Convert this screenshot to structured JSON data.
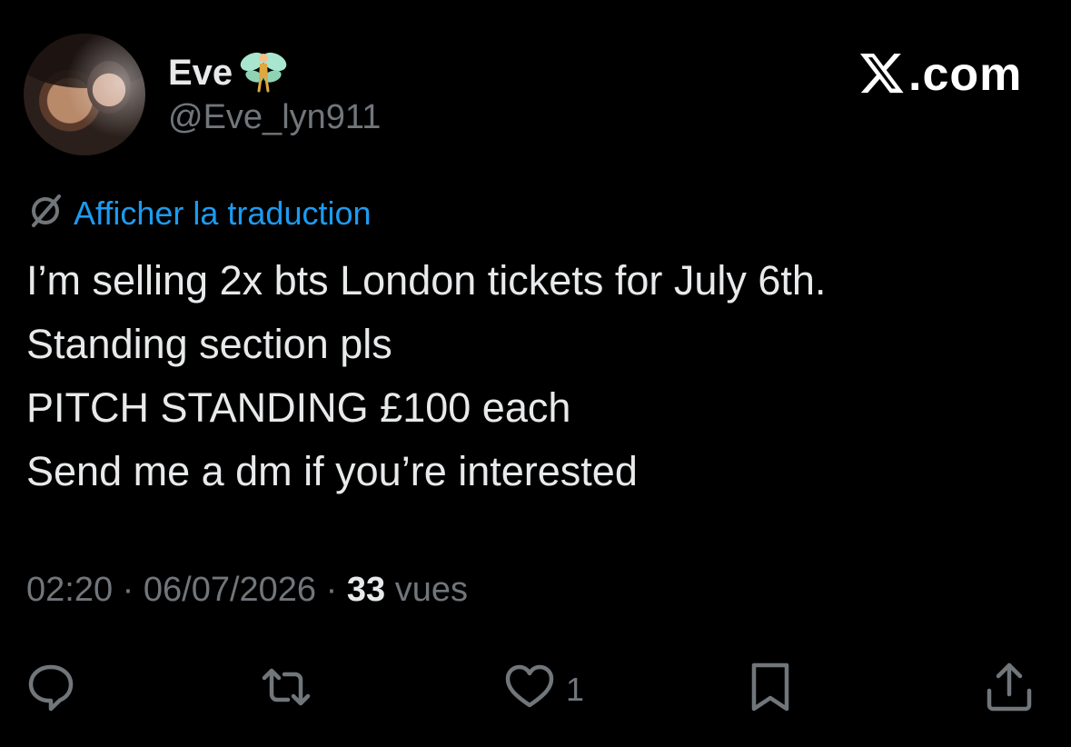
{
  "author": {
    "name": "Eve",
    "handle": "@Eve_lyn911",
    "emoji_icon": "fairy-emoji"
  },
  "brand": {
    "site": ".com",
    "logo_icon": "x-logo-icon"
  },
  "translate": {
    "label": "Afficher la traduction",
    "icon": "translate-icon",
    "color": "#1d9bf0"
  },
  "tweet": {
    "lines": [
      "I’m selling 2x bts London tickets for July 6th.",
      "Standing section pls",
      "PITCH STANDING £100 each",
      "Send me a dm if you’re interested"
    ]
  },
  "meta": {
    "time": "02:20",
    "date": "06/07/2026",
    "separator": "·",
    "views_count": "33",
    "views_label": "vues"
  },
  "actions": {
    "reply": {
      "icon": "reply-icon"
    },
    "retweet": {
      "icon": "retweet-icon"
    },
    "like": {
      "icon": "heart-icon",
      "count": "1"
    },
    "bookmark": {
      "icon": "bookmark-icon"
    },
    "share": {
      "icon": "share-icon"
    }
  },
  "colors": {
    "background": "#000000",
    "text": "#e7e9ea",
    "muted": "#71767b"
  }
}
